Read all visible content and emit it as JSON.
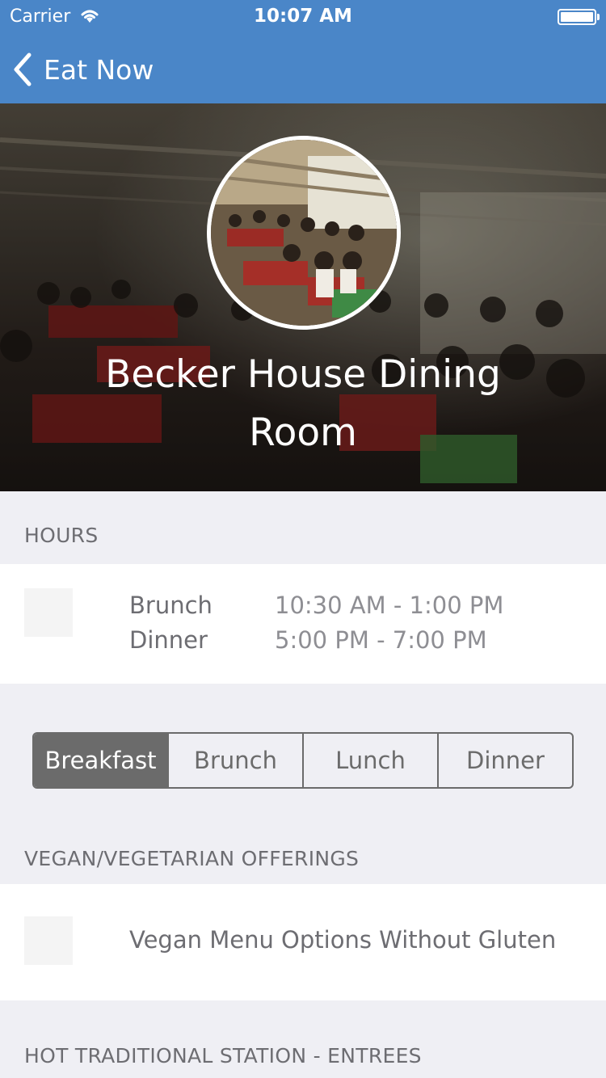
{
  "status_bar": {
    "carrier": "Carrier",
    "time": "10:07 AM"
  },
  "nav": {
    "back_label": "Eat Now"
  },
  "hero": {
    "title": "Becker House Dining Room"
  },
  "hours": {
    "header": "HOURS",
    "rows": [
      {
        "meal": "Brunch",
        "time": "10:30 AM - 1:00 PM"
      },
      {
        "meal": "Dinner",
        "time": "5:00 PM - 7:00 PM"
      }
    ]
  },
  "meal_tabs": {
    "items": [
      "Breakfast",
      "Brunch",
      "Lunch",
      "Dinner"
    ],
    "selected": "Breakfast"
  },
  "vegan": {
    "header": "VEGAN/VEGETARIAN OFFERINGS",
    "items": [
      "Vegan Menu Options Without Gluten"
    ]
  },
  "hot_station": {
    "header": "HOT TRADITIONAL STATION - ENTREES"
  },
  "colors": {
    "nav_bar": "#4a86c8",
    "background": "#efeff4",
    "segment_active": "#6b6b6b"
  }
}
